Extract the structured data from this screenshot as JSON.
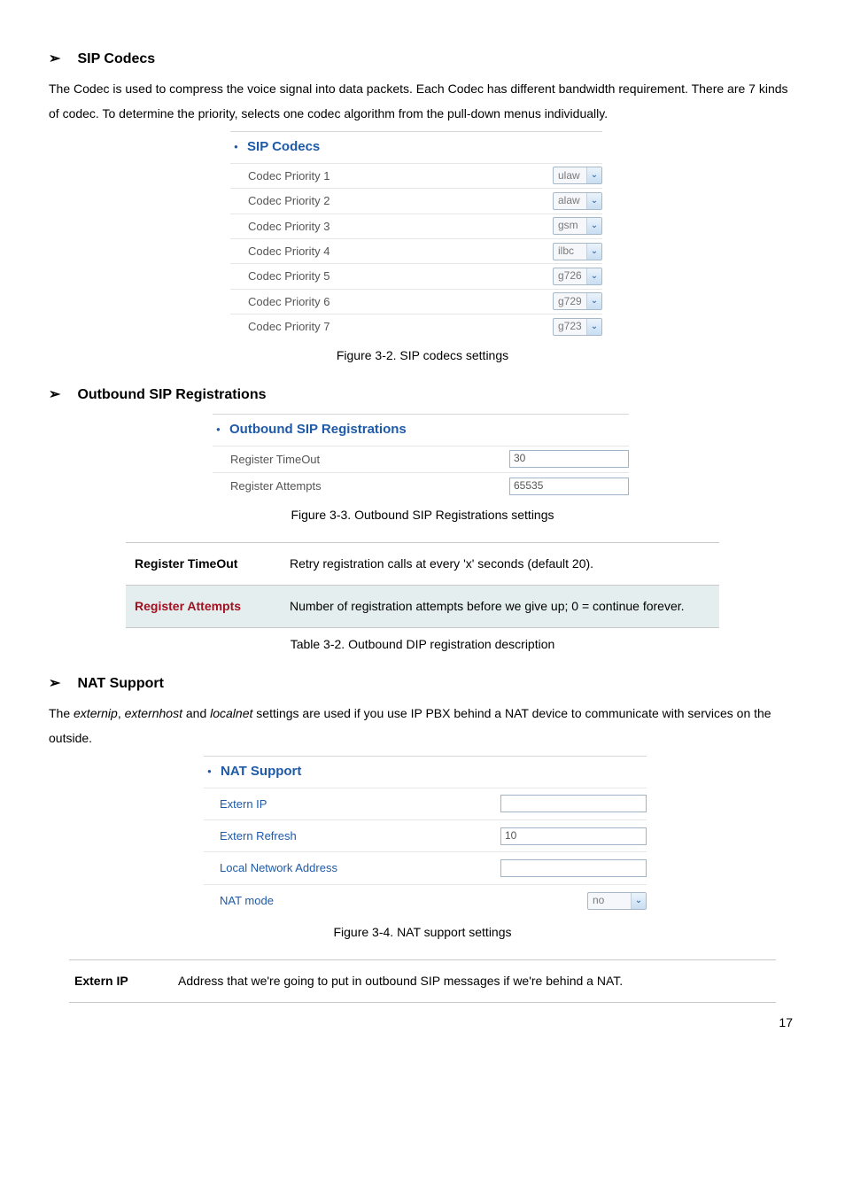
{
  "section1": {
    "title": "SIP Codecs",
    "body": "The Codec is used to compress the voice signal into data packets. Each Codec has different bandwidth requirement. There are 7 kinds of codec. To determine the priority, selects one codec algorithm from the pull-down menus individually.",
    "widget_title": "SIP Codecs",
    "rows": [
      {
        "label": "Codec Priority 1",
        "value": "ulaw"
      },
      {
        "label": "Codec Priority 2",
        "value": "alaw"
      },
      {
        "label": "Codec Priority 3",
        "value": "gsm"
      },
      {
        "label": "Codec Priority 4",
        "value": "ilbc"
      },
      {
        "label": "Codec Priority 5",
        "value": "g726"
      },
      {
        "label": "Codec Priority 6",
        "value": "g729"
      },
      {
        "label": "Codec Priority 7",
        "value": "g723"
      }
    ],
    "caption": "Figure 3-2. SIP codecs settings"
  },
  "section2": {
    "title": "Outbound SIP Registrations",
    "widget_title": "Outbound SIP Registrations",
    "rows": [
      {
        "label": "Register TimeOut",
        "value": "30"
      },
      {
        "label": "Register Attempts",
        "value": "65535"
      }
    ],
    "caption": "Figure 3-3. Outbound SIP Registrations settings",
    "table": [
      {
        "name": "Register TimeOut",
        "desc": "Retry registration calls at every 'x' seconds (default 20)."
      },
      {
        "name": "Register Attempts",
        "desc": "Number of registration attempts before we give up; 0 = continue forever."
      }
    ],
    "table_caption": "Table 3-2. Outbound DIP registration description"
  },
  "section3": {
    "title": "NAT Support",
    "body_parts": {
      "p1": "The ",
      "i1": "externip",
      "c1": ", ",
      "i2": "externhost",
      "c2": " and ",
      "i3": "localnet",
      "p2": " settings are used if you use IP PBX behind a NAT device to communicate with services on the outside."
    },
    "widget_title": "NAT Support",
    "rows": [
      {
        "label": "Extern IP",
        "type": "text",
        "value": ""
      },
      {
        "label": "Extern Refresh",
        "type": "text",
        "value": "10"
      },
      {
        "label": "Local Network Address",
        "type": "text",
        "value": ""
      },
      {
        "label": "NAT mode",
        "type": "select",
        "value": "no"
      }
    ],
    "caption": "Figure 3-4. NAT support settings",
    "table": [
      {
        "name": "Extern IP",
        "desc": "Address that we're going to put in outbound SIP messages if we're behind a NAT."
      }
    ]
  },
  "page_number": "17"
}
